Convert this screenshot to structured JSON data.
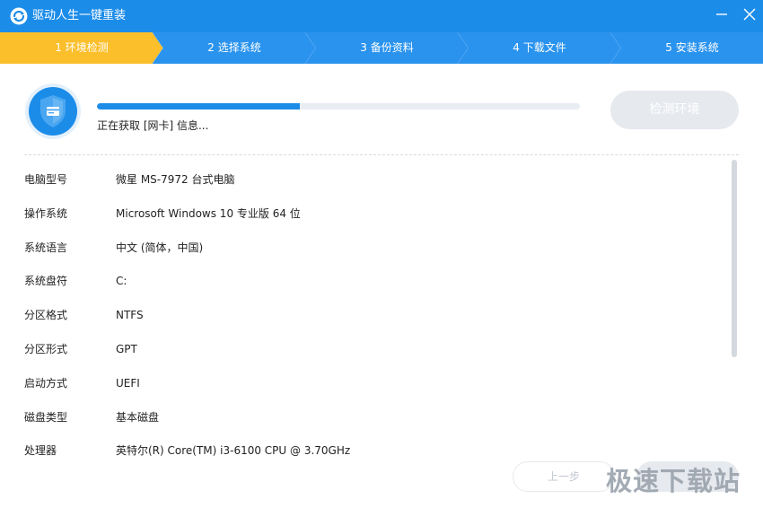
{
  "window": {
    "title": "驱动人生一键重装",
    "app_icon": "refresh-logo-icon",
    "minimize_icon": "minimize-icon",
    "close_icon": "close-icon"
  },
  "steps": [
    {
      "label": "1 环境检测",
      "active": true
    },
    {
      "label": "2 选择系统",
      "active": false
    },
    {
      "label": "3 备份资料",
      "active": false
    },
    {
      "label": "4 下载文件",
      "active": false
    },
    {
      "label": "5 安装系统",
      "active": false
    }
  ],
  "detection": {
    "icon": "shield-icon",
    "progress_fraction": 0.42,
    "status": "正在获取 [网卡] 信息...",
    "button_label": "检测环境"
  },
  "system_info": [
    {
      "label": "电脑型号",
      "value": "微星 MS-7972 台式电脑"
    },
    {
      "label": "操作系统",
      "value": "Microsoft Windows 10 专业版 64 位"
    },
    {
      "label": "系统语言",
      "value": "中文 (简体，中国)"
    },
    {
      "label": "系统盘符",
      "value": "C:"
    },
    {
      "label": "分区格式",
      "value": "NTFS"
    },
    {
      "label": "分区形式",
      "value": "GPT"
    },
    {
      "label": "启动方式",
      "value": "UEFI"
    },
    {
      "label": "磁盘类型",
      "value": "基本磁盘"
    },
    {
      "label": "处理器",
      "value": "英特尔(R) Core(TM) i3-6100 CPU @ 3.70GHz"
    }
  ],
  "footer": {
    "prev_label": "上一步",
    "watermark": "极速下载站"
  },
  "colors": {
    "accent": "#1c8ce9",
    "active_step": "#fbbf2c",
    "step_bg": "#2a93ee",
    "disabled_button": "#e6e9ee"
  }
}
